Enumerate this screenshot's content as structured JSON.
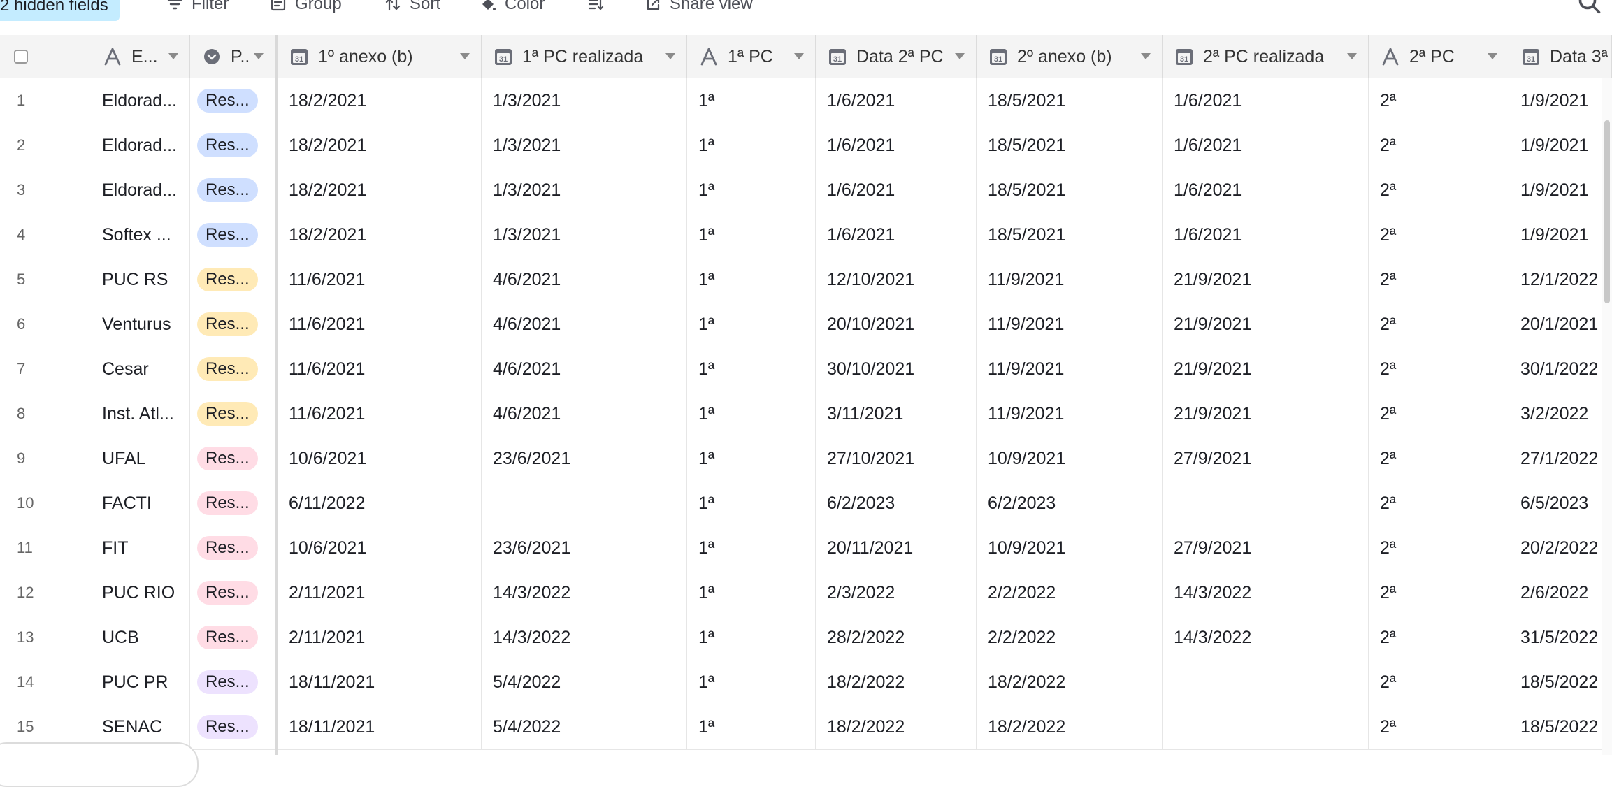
{
  "toolbar": {
    "hidden_fields": "2 hidden fields",
    "filter": "Filter",
    "group": "Group",
    "sort": "Sort",
    "color": "Color",
    "share_view": "Share view"
  },
  "columns": [
    {
      "label": "E...",
      "type_icon": "text-type-icon"
    },
    {
      "label": "P..",
      "type_icon": "single-select-type-icon"
    },
    {
      "label": "1º anexo (b)",
      "type_icon": "date-type-icon"
    },
    {
      "label": "1ª PC realizada",
      "type_icon": "date-type-icon"
    },
    {
      "label": "1ª PC",
      "type_icon": "text-type-icon"
    },
    {
      "label": "Data 2ª PC",
      "type_icon": "date-type-icon"
    },
    {
      "label": "2º anexo (b)",
      "type_icon": "date-type-icon"
    },
    {
      "label": "2ª PC realizada",
      "type_icon": "date-type-icon"
    },
    {
      "label": "2ª PC",
      "type_icon": "text-type-icon"
    },
    {
      "label": "Data 3ª",
      "type_icon": "date-type-icon"
    }
  ],
  "pill_colors": {
    "blue": "#cfdfff",
    "yellow": "#ffeab6",
    "pink": "#ffdce5",
    "purple": "#ede2fe"
  },
  "rows": [
    {
      "n": "1",
      "entity": "Eldorad...",
      "p": "Res...",
      "pc": "blue",
      "c1": "18/2/2021",
      "c2": "1/3/2021",
      "c3": "1ª",
      "c4": "1/6/2021",
      "c5": "18/5/2021",
      "c6": "1/6/2021",
      "c7": "2ª",
      "c8": "1/9/2021"
    },
    {
      "n": "2",
      "entity": "Eldorad...",
      "p": "Res...",
      "pc": "blue",
      "c1": "18/2/2021",
      "c2": "1/3/2021",
      "c3": "1ª",
      "c4": "1/6/2021",
      "c5": "18/5/2021",
      "c6": "1/6/2021",
      "c7": "2ª",
      "c8": "1/9/2021"
    },
    {
      "n": "3",
      "entity": "Eldorad...",
      "p": "Res...",
      "pc": "blue",
      "c1": "18/2/2021",
      "c2": "1/3/2021",
      "c3": "1ª",
      "c4": "1/6/2021",
      "c5": "18/5/2021",
      "c6": "1/6/2021",
      "c7": "2ª",
      "c8": "1/9/2021"
    },
    {
      "n": "4",
      "entity": "Softex ...",
      "p": "Res...",
      "pc": "blue",
      "c1": "18/2/2021",
      "c2": "1/3/2021",
      "c3": "1ª",
      "c4": "1/6/2021",
      "c5": "18/5/2021",
      "c6": "1/6/2021",
      "c7": "2ª",
      "c8": "1/9/2021"
    },
    {
      "n": "5",
      "entity": "PUC RS",
      "p": "Res...",
      "pc": "yellow",
      "c1": "11/6/2021",
      "c2": "4/6/2021",
      "c3": "1ª",
      "c4": "12/10/2021",
      "c5": "11/9/2021",
      "c6": "21/9/2021",
      "c7": "2ª",
      "c8": "12/1/2022"
    },
    {
      "n": "6",
      "entity": "Venturus",
      "p": "Res...",
      "pc": "yellow",
      "c1": "11/6/2021",
      "c2": "4/6/2021",
      "c3": "1ª",
      "c4": "20/10/2021",
      "c5": "11/9/2021",
      "c6": "21/9/2021",
      "c7": "2ª",
      "c8": "20/1/2021"
    },
    {
      "n": "7",
      "entity": "Cesar",
      "p": "Res...",
      "pc": "yellow",
      "c1": "11/6/2021",
      "c2": "4/6/2021",
      "c3": "1ª",
      "c4": "30/10/2021",
      "c5": "11/9/2021",
      "c6": "21/9/2021",
      "c7": "2ª",
      "c8": "30/1/2022"
    },
    {
      "n": "8",
      "entity": "Inst. Atl...",
      "p": "Res...",
      "pc": "yellow",
      "c1": "11/6/2021",
      "c2": "4/6/2021",
      "c3": "1ª",
      "c4": "3/11/2021",
      "c5": "11/9/2021",
      "c6": "21/9/2021",
      "c7": "2ª",
      "c8": "3/2/2022"
    },
    {
      "n": "9",
      "entity": "UFAL",
      "p": "Res...",
      "pc": "pink",
      "c1": "10/6/2021",
      "c2": "23/6/2021",
      "c3": "1ª",
      "c4": "27/10/2021",
      "c5": "10/9/2021",
      "c6": "27/9/2021",
      "c7": "2ª",
      "c8": "27/1/2022"
    },
    {
      "n": "10",
      "entity": "FACTI",
      "p": "Res...",
      "pc": "pink",
      "c1": "6/11/2022",
      "c2": "",
      "c3": "1ª",
      "c4": "6/2/2023",
      "c5": "6/2/2023",
      "c6": "",
      "c7": "2ª",
      "c8": "6/5/2023"
    },
    {
      "n": "11",
      "entity": "FIT",
      "p": "Res...",
      "pc": "pink",
      "c1": "10/6/2021",
      "c2": "23/6/2021",
      "c3": "1ª",
      "c4": "20/11/2021",
      "c5": "10/9/2021",
      "c6": "27/9/2021",
      "c7": "2ª",
      "c8": "20/2/2022"
    },
    {
      "n": "12",
      "entity": "PUC RIO",
      "p": "Res...",
      "pc": "pink",
      "c1": "2/11/2021",
      "c2": "14/3/2022",
      "c3": "1ª",
      "c4": "2/3/2022",
      "c5": "2/2/2022",
      "c6": "14/3/2022",
      "c7": "2ª",
      "c8": "2/6/2022"
    },
    {
      "n": "13",
      "entity": "UCB",
      "p": "Res...",
      "pc": "pink",
      "c1": "2/11/2021",
      "c2": "14/3/2022",
      "c3": "1ª",
      "c4": "28/2/2022",
      "c5": "2/2/2022",
      "c6": "14/3/2022",
      "c7": "2ª",
      "c8": "31/5/2022"
    },
    {
      "n": "14",
      "entity": "PUC PR",
      "p": "Res...",
      "pc": "purple",
      "c1": "18/11/2021",
      "c2": "5/4/2022",
      "c3": "1ª",
      "c4": "18/2/2022",
      "c5": "18/2/2022",
      "c6": "",
      "c7": "2ª",
      "c8": "18/5/2022"
    },
    {
      "n": "15",
      "entity": "SENAC",
      "p": "Res...",
      "pc": "purple",
      "c1": "18/11/2021",
      "c2": "5/4/2022",
      "c3": "1ª",
      "c4": "18/2/2022",
      "c5": "18/2/2022",
      "c6": "",
      "c7": "2ª",
      "c8": "18/5/2022"
    }
  ]
}
